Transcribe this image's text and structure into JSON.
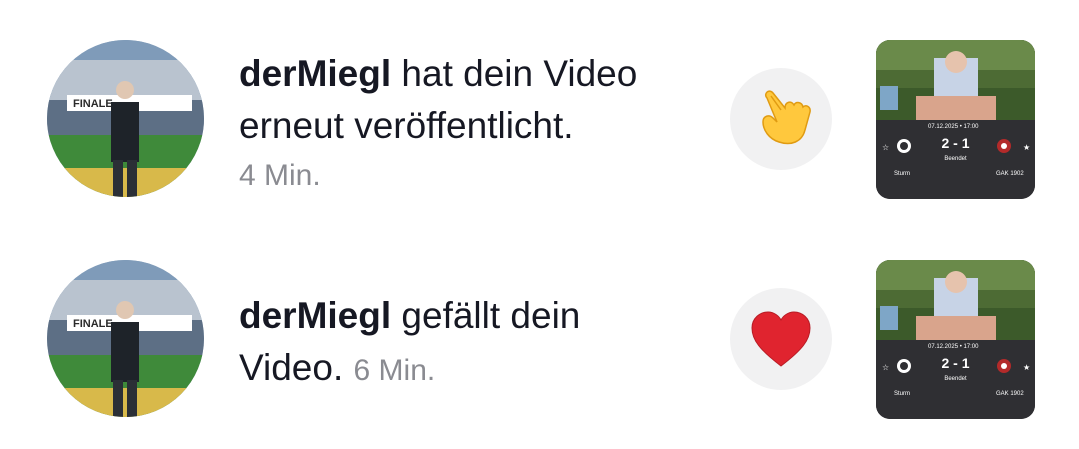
{
  "notifications": [
    {
      "username": "derMiegl",
      "message": " hat dein Video erneut veröffentlicht.",
      "time": "4 Min.",
      "reaction_icon": "pointing-hand-emoji",
      "thumbnail": {
        "date": "07.12.2025 • 17:00",
        "score": "2 - 1",
        "status": "Beendet",
        "team_home": "Sturm",
        "team_away": "GAK 1902"
      }
    },
    {
      "username": "derMiegl",
      "message": " gefällt dein Video.",
      "time": "6 Min.",
      "reaction_icon": "red-heart-emoji",
      "thumbnail": {
        "date": "07.12.2025 • 17:00",
        "score": "2 - 1",
        "status": "Beendet",
        "team_home": "Sturm",
        "team_away": "GAK 1902"
      }
    }
  ],
  "avatar_banner": "FINALE",
  "colors": {
    "text_primary": "#161823",
    "text_secondary": "#8a8b91",
    "reaction_bg": "#f1f1f2",
    "heart": "#e0242f"
  }
}
